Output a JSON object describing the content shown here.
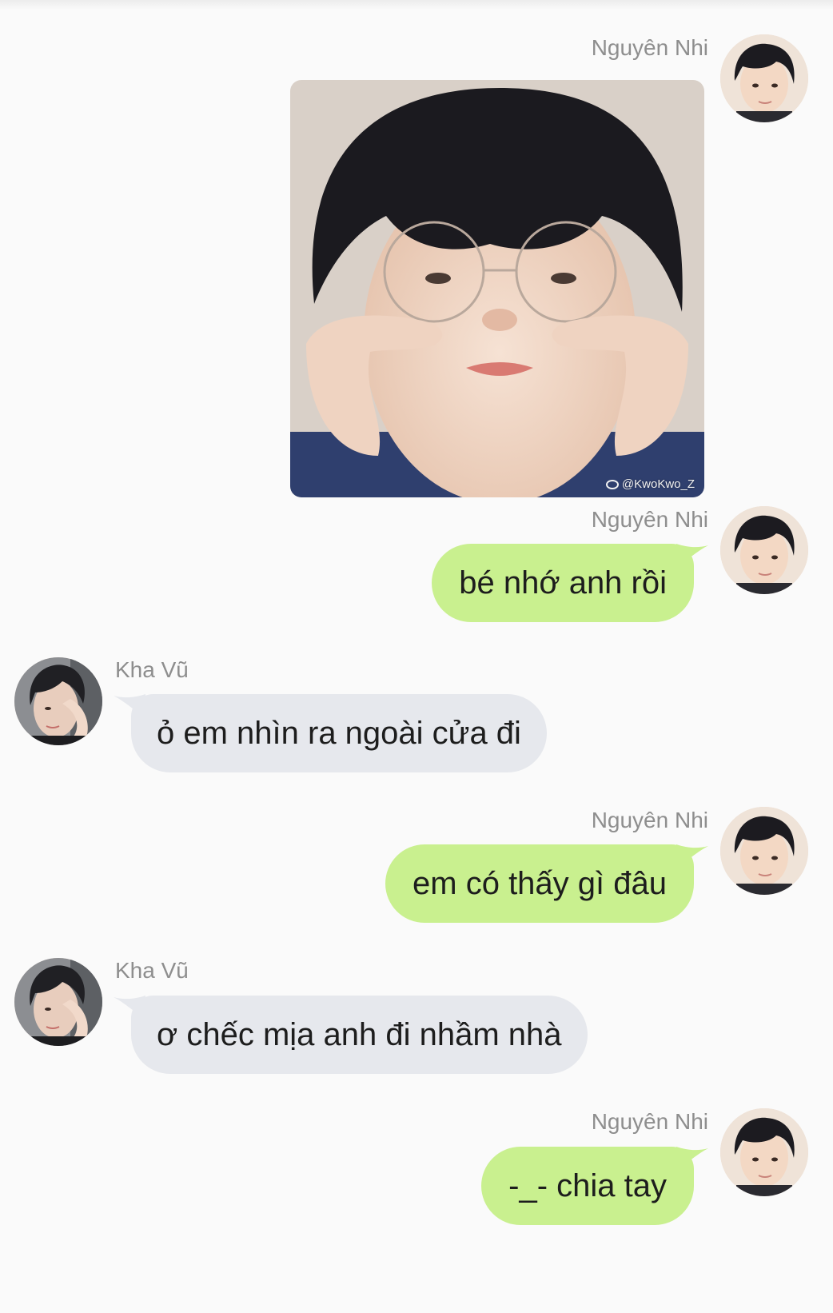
{
  "users": {
    "me": {
      "name": "Nguyên Nhi"
    },
    "other": {
      "name": "Kha Vũ"
    }
  },
  "messages": [
    {
      "from": "me",
      "sender": "Nguyên Nhi",
      "type": "image",
      "watermark": "@KwoKwo_Z"
    },
    {
      "from": "me",
      "sender": "Nguyên Nhi",
      "type": "text",
      "text": "bé nhớ anh rồi"
    },
    {
      "from": "other",
      "sender": "Kha Vũ",
      "type": "text",
      "text": "ỏ em nhìn ra ngoài cửa đi"
    },
    {
      "from": "me",
      "sender": "Nguyên Nhi",
      "type": "text",
      "text": "em có thấy gì đâu"
    },
    {
      "from": "other",
      "sender": "Kha Vũ",
      "type": "text",
      "text": "ơ chếc mịa anh đi nhầm nhà"
    },
    {
      "from": "me",
      "sender": "Nguyên Nhi",
      "type": "text",
      "text": "-_- chia tay"
    }
  ],
  "colors": {
    "my_bubble": "#c9f08f",
    "other_bubble": "#e6e8ed",
    "sender_name": "#8e8e8e",
    "background": "#fafafa"
  }
}
